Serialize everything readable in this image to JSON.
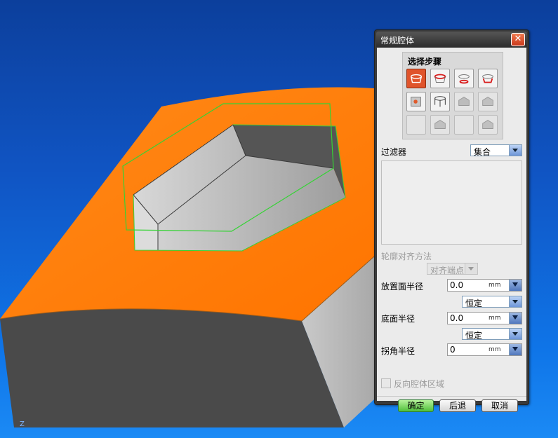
{
  "dialog": {
    "title": "常规腔体",
    "close_glyph": "✕",
    "steps_title": "选择步骤",
    "steps": [
      {
        "icon": "placement-face-icon",
        "state": "active"
      },
      {
        "icon": "top-face-icon",
        "state": "normal"
      },
      {
        "icon": "bottom-face-icon",
        "state": "normal"
      },
      {
        "icon": "bottom-outline-icon",
        "state": "normal"
      },
      {
        "icon": "placement-curve-icon",
        "state": "normal"
      },
      {
        "icon": "floor-outline-icon",
        "state": "normal"
      },
      {
        "icon": "target-body-icon",
        "state": "disabled"
      },
      {
        "icon": "place-outline-icon",
        "state": "disabled"
      },
      {
        "icon": "blank-step-icon",
        "state": "disabled"
      },
      {
        "icon": "floor-curve-icon",
        "state": "disabled"
      },
      {
        "icon": "blank-step-icon",
        "state": "disabled"
      },
      {
        "icon": "through-face-icon",
        "state": "disabled"
      }
    ],
    "filter_label": "过滤器",
    "filter_value": "集合",
    "alignment_label": "轮廓对齐方法",
    "alignment_value": "对齐端点",
    "placement_radius_label": "放置面半径",
    "placement_radius_value": "0.0",
    "placement_radius_unit": "mm",
    "placement_radius_mode": "恒定",
    "floor_radius_label": "底面半径",
    "floor_radius_value": "0.0",
    "floor_radius_unit": "mm",
    "floor_radius_mode": "恒定",
    "corner_radius_label": "拐角半径",
    "corner_radius_value": "0",
    "corner_radius_unit": "mm",
    "reverse_label": "反向腔体区域",
    "ok_label": "确定",
    "back_label": "后退",
    "cancel_label": "取消"
  },
  "colors": {
    "background_top": "#0c3f9c",
    "background_bottom": "#1b8af5",
    "top_face": "#ff7f10",
    "side_face_dark": "#4a4a4a",
    "side_face_light": "#c4c4c4",
    "pocket_floor": "#b8b8b8",
    "outline": "#35d335",
    "active_step": "#e0542b",
    "ok_button": "#4fbf3a"
  },
  "triad_label": "Z"
}
